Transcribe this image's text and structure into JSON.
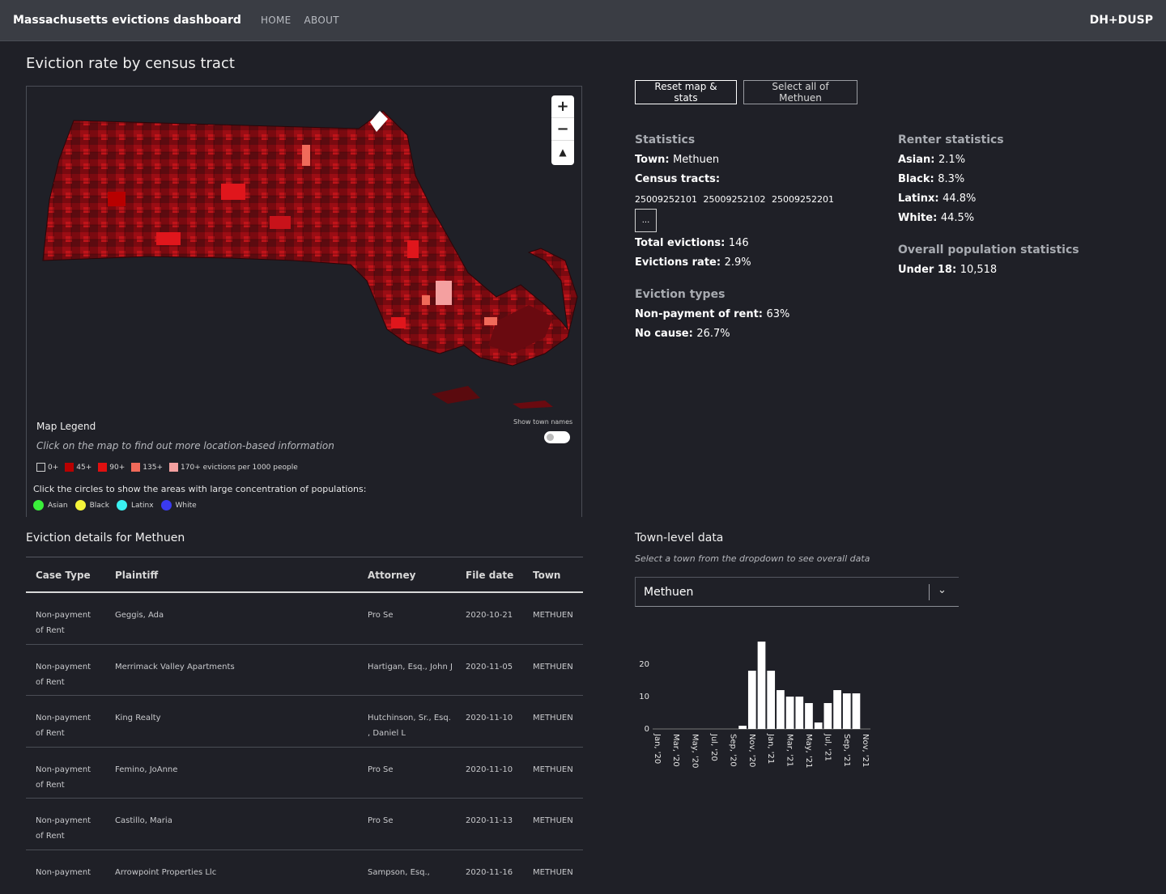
{
  "nav": {
    "brand": "Massachusetts evictions dashboard",
    "links": [
      "HOME",
      "ABOUT"
    ],
    "org": "DH+DUSP"
  },
  "map": {
    "title": "Eviction rate by census tract",
    "zoom_in": "+",
    "zoom_out": "−",
    "reset_north": "▲",
    "legend_title": "Map Legend",
    "legend_hint": "Click on the map to find out more location-based information",
    "legend_items": [
      {
        "label": "0+",
        "color": "#1f2027"
      },
      {
        "label": "45+",
        "color": "#b80000"
      },
      {
        "label": "90+",
        "color": "#e01010"
      },
      {
        "label": "135+",
        "color": "#f06a5a"
      },
      {
        "label": "170+ evictions per 1000 people",
        "color": "#f4a0a0"
      }
    ],
    "circles_hint": "Click the circles to show the areas with large concentration of populations:",
    "circles": [
      {
        "label": "Asian",
        "color": "#3aef3a"
      },
      {
        "label": "Black",
        "color": "#f4f43a"
      },
      {
        "label": "Latinx",
        "color": "#3af0f0"
      },
      {
        "label": "White",
        "color": "#3a3af0"
      }
    ],
    "toggle_label": "Show town names"
  },
  "buttons": {
    "reset": "Reset map & stats",
    "select_all": "Select all of Methuen"
  },
  "stats": {
    "heading": "Statistics",
    "town_label": "Town:",
    "town_value": "Methuen",
    "tracts_label": "Census tracts:",
    "tracts": "25009252101 25009252102 25009252201",
    "more": "...",
    "total_label": "Total evictions:",
    "total_value": "146",
    "rate_label": "Evictions rate:",
    "rate_value": "2.9%",
    "types_heading": "Eviction types",
    "nonpay_label": "Non-payment of rent:",
    "nonpay_value": "63%",
    "nocause_label": "No cause:",
    "nocause_value": "26.7%"
  },
  "renter": {
    "heading": "Renter statistics",
    "asian_label": "Asian:",
    "asian_value": "2.1%",
    "black_label": "Black:",
    "black_value": "8.3%",
    "latinx_label": "Latinx:",
    "latinx_value": "44.8%",
    "white_label": "White:",
    "white_value": "44.5%",
    "overall_heading": "Overall population statistics",
    "under18_label": "Under 18:",
    "under18_value": "10,518"
  },
  "details": {
    "title": "Eviction details for Methuen",
    "columns": [
      "Case Type",
      "Plaintiff",
      "Attorney",
      "File date",
      "Town"
    ],
    "rows": [
      [
        "Non-payment of Rent",
        "Geggis, Ada",
        "Pro Se",
        "2020-10-21",
        "METHUEN"
      ],
      [
        "Non-payment of Rent",
        "Merrimack Valley Apartments",
        "Hartigan, Esq., John J",
        "2020-11-05",
        "METHUEN"
      ],
      [
        "Non-payment of Rent",
        "King Realty",
        "Hutchinson, Sr., Esq. , Daniel L",
        "2020-11-10",
        "METHUEN"
      ],
      [
        "Non-payment of Rent",
        "Femino, JoAnne",
        "Pro Se",
        "2020-11-10",
        "METHUEN"
      ],
      [
        "Non-payment of Rent",
        "Castillo, Maria",
        "Pro Se",
        "2020-11-13",
        "METHUEN"
      ],
      [
        "Non-payment",
        "Arrowpoint Properties Llc",
        "Sampson, Esq.,",
        "2020-11-16",
        "METHUEN"
      ]
    ]
  },
  "town": {
    "title": "Town-level data",
    "hint": "Select a town from the dropdown to see overall data",
    "selected": "Methuen"
  },
  "chart_data": {
    "type": "bar",
    "x": [
      "2020-01",
      "2020-02",
      "2020-03",
      "2020-04",
      "2020-05",
      "2020-06",
      "2020-07",
      "2020-08",
      "2020-09",
      "2020-10",
      "2020-11",
      "2020-12",
      "2021-01",
      "2021-02",
      "2021-03",
      "2021-04",
      "2021-05",
      "2021-06",
      "2021-07",
      "2021-08",
      "2021-09",
      "2021-10",
      "2021-11"
    ],
    "values": [
      0,
      0,
      0,
      0,
      0,
      0,
      0,
      0,
      0,
      1,
      18,
      27,
      18,
      12,
      10,
      10,
      8,
      2,
      8,
      12,
      11,
      11,
      0
    ],
    "tick_labels": [
      "Jan, '20",
      "Mar, '20",
      "May, '20",
      "Jul, '20",
      "Sep, '20",
      "Nov, '20",
      "Jan, '21",
      "Mar, '21",
      "May, '21",
      "Jul, '21",
      "Sep, '21",
      "Nov, '21"
    ],
    "y_ticks": [
      "0",
      "10",
      "20"
    ],
    "ylim": [
      0,
      28
    ],
    "bar_color": "#ffffff"
  }
}
